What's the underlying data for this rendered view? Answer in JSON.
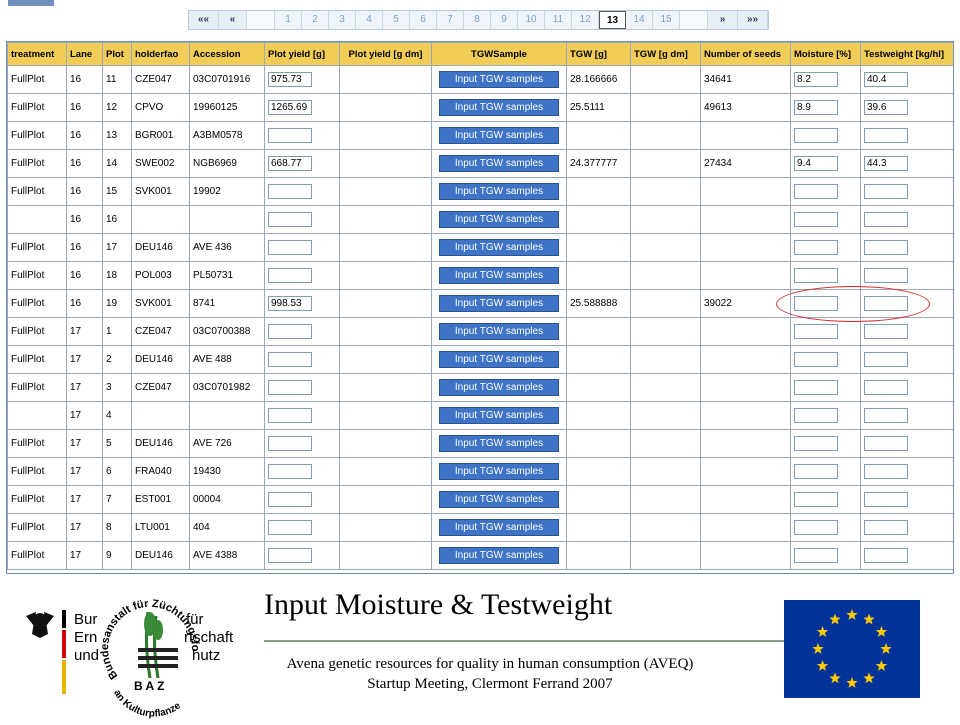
{
  "pager": {
    "first": "««",
    "prev": "«",
    "next": "»",
    "last": "»»",
    "pages": [
      "1",
      "2",
      "3",
      "4",
      "5",
      "6",
      "7",
      "8",
      "9",
      "10",
      "11",
      "12",
      "13",
      "14",
      "15"
    ],
    "current": "13"
  },
  "table": {
    "headers": [
      "treatment",
      "Lane",
      "Plot",
      "holderfao",
      "Accession",
      "Plot yield [g]",
      "Plot yield [g dm]",
      "TGWSample",
      "TGW [g]",
      "TGW [g dm]",
      "Number of seeds",
      "Moisture [%]",
      "Testweight [kg/hl]"
    ],
    "button_label": "Input TGW samples",
    "rows": [
      {
        "treatment": "FullPlot",
        "lane": "16",
        "plot": "11",
        "holder": "CZE047",
        "accession": "03C0701916",
        "yield": "975.73",
        "tgw": "28.166666",
        "seeds": "34641",
        "moisture": "8.2",
        "testweight": "40.4"
      },
      {
        "treatment": "FullPlot",
        "lane": "16",
        "plot": "12",
        "holder": "CPVO",
        "accession": "19960125",
        "yield": "1265.69",
        "tgw": "25.5111",
        "seeds": "49613",
        "moisture": "8.9",
        "testweight": "39.6"
      },
      {
        "treatment": "FullPlot",
        "lane": "16",
        "plot": "13",
        "holder": "BGR001",
        "accession": "A3BM0578",
        "yield": "",
        "tgw": "",
        "seeds": "",
        "moisture": "",
        "testweight": ""
      },
      {
        "treatment": "FullPlot",
        "lane": "16",
        "plot": "14",
        "holder": "SWE002",
        "accession": "NGB6969",
        "yield": "668.77",
        "tgw": "24.377777",
        "seeds": "27434",
        "moisture": "9.4",
        "testweight": "44.3"
      },
      {
        "treatment": "FullPlot",
        "lane": "16",
        "plot": "15",
        "holder": "SVK001",
        "accession": "19902",
        "yield": "",
        "tgw": "",
        "seeds": "",
        "moisture": "",
        "testweight": ""
      },
      {
        "treatment": "",
        "lane": "16",
        "plot": "16",
        "holder": "",
        "accession": "",
        "yield": "",
        "tgw": "",
        "seeds": "",
        "moisture": "",
        "testweight": ""
      },
      {
        "treatment": "FullPlot",
        "lane": "16",
        "plot": "17",
        "holder": "DEU146",
        "accession": "AVE 436",
        "yield": "",
        "tgw": "",
        "seeds": "",
        "moisture": "",
        "testweight": ""
      },
      {
        "treatment": "FullPlot",
        "lane": "16",
        "plot": "18",
        "holder": "POL003",
        "accession": "PL50731",
        "yield": "",
        "tgw": "",
        "seeds": "",
        "moisture": "",
        "testweight": ""
      },
      {
        "treatment": "FullPlot",
        "lane": "16",
        "plot": "19",
        "holder": "SVK001",
        "accession": "8741",
        "yield": "998.53",
        "tgw": "25.588888",
        "seeds": "39022",
        "moisture": "",
        "testweight": ""
      },
      {
        "treatment": "FullPlot",
        "lane": "17",
        "plot": "1",
        "holder": "CZE047",
        "accession": "03C0700388",
        "yield": "",
        "tgw": "",
        "seeds": "",
        "moisture": "",
        "testweight": ""
      },
      {
        "treatment": "FullPlot",
        "lane": "17",
        "plot": "2",
        "holder": "DEU146",
        "accession": "AVE 488",
        "yield": "",
        "tgw": "",
        "seeds": "",
        "moisture": "",
        "testweight": ""
      },
      {
        "treatment": "FullPlot",
        "lane": "17",
        "plot": "3",
        "holder": "CZE047",
        "accession": "03C0701982",
        "yield": "",
        "tgw": "",
        "seeds": "",
        "moisture": "",
        "testweight": ""
      },
      {
        "treatment": "",
        "lane": "17",
        "plot": "4",
        "holder": "",
        "accession": "",
        "yield": "",
        "tgw": "",
        "seeds": "",
        "moisture": "",
        "testweight": ""
      },
      {
        "treatment": "FullPlot",
        "lane": "17",
        "plot": "5",
        "holder": "DEU146",
        "accession": "AVE 726",
        "yield": "",
        "tgw": "",
        "seeds": "",
        "moisture": "",
        "testweight": ""
      },
      {
        "treatment": "FullPlot",
        "lane": "17",
        "plot": "6",
        "holder": "FRA040",
        "accession": "19430",
        "yield": "",
        "tgw": "",
        "seeds": "",
        "moisture": "",
        "testweight": ""
      },
      {
        "treatment": "FullPlot",
        "lane": "17",
        "plot": "7",
        "holder": "EST001",
        "accession": "00004",
        "yield": "",
        "tgw": "",
        "seeds": "",
        "moisture": "",
        "testweight": ""
      },
      {
        "treatment": "FullPlot",
        "lane": "17",
        "plot": "8",
        "holder": "LTU001",
        "accession": "404",
        "yield": "",
        "tgw": "",
        "seeds": "",
        "moisture": "",
        "testweight": ""
      },
      {
        "treatment": "FullPlot",
        "lane": "17",
        "plot": "9",
        "holder": "DEU146",
        "accession": "AVE 4388",
        "yield": "",
        "tgw": "",
        "seeds": "",
        "moisture": "",
        "testweight": ""
      }
    ]
  },
  "footer": {
    "title": "Input Moisture & Testweight",
    "subtitle_line1": "Avena genetic resources for quality in human consumption (AVEQ)",
    "subtitle_line2": "Startup Meeting, Clermont Ferrand 2007",
    "logo_text": {
      "ministry_lines": [
        "Bur",
        "Ern",
        "und"
      ],
      "ministry_right": [
        "für",
        "rtschaft",
        "hutz"
      ],
      "arc_top": "Bundesanstalt für Züchtungsforschung",
      "arc_bottom": "an Kulturpflanzen",
      "baz": "B A Z"
    }
  },
  "colors": {
    "header_bg": "#f1cd57",
    "button_bg": "#3e73c6",
    "highlight": "#d62a2a",
    "eu_blue": "#003399",
    "eu_star": "#ffcc00"
  }
}
